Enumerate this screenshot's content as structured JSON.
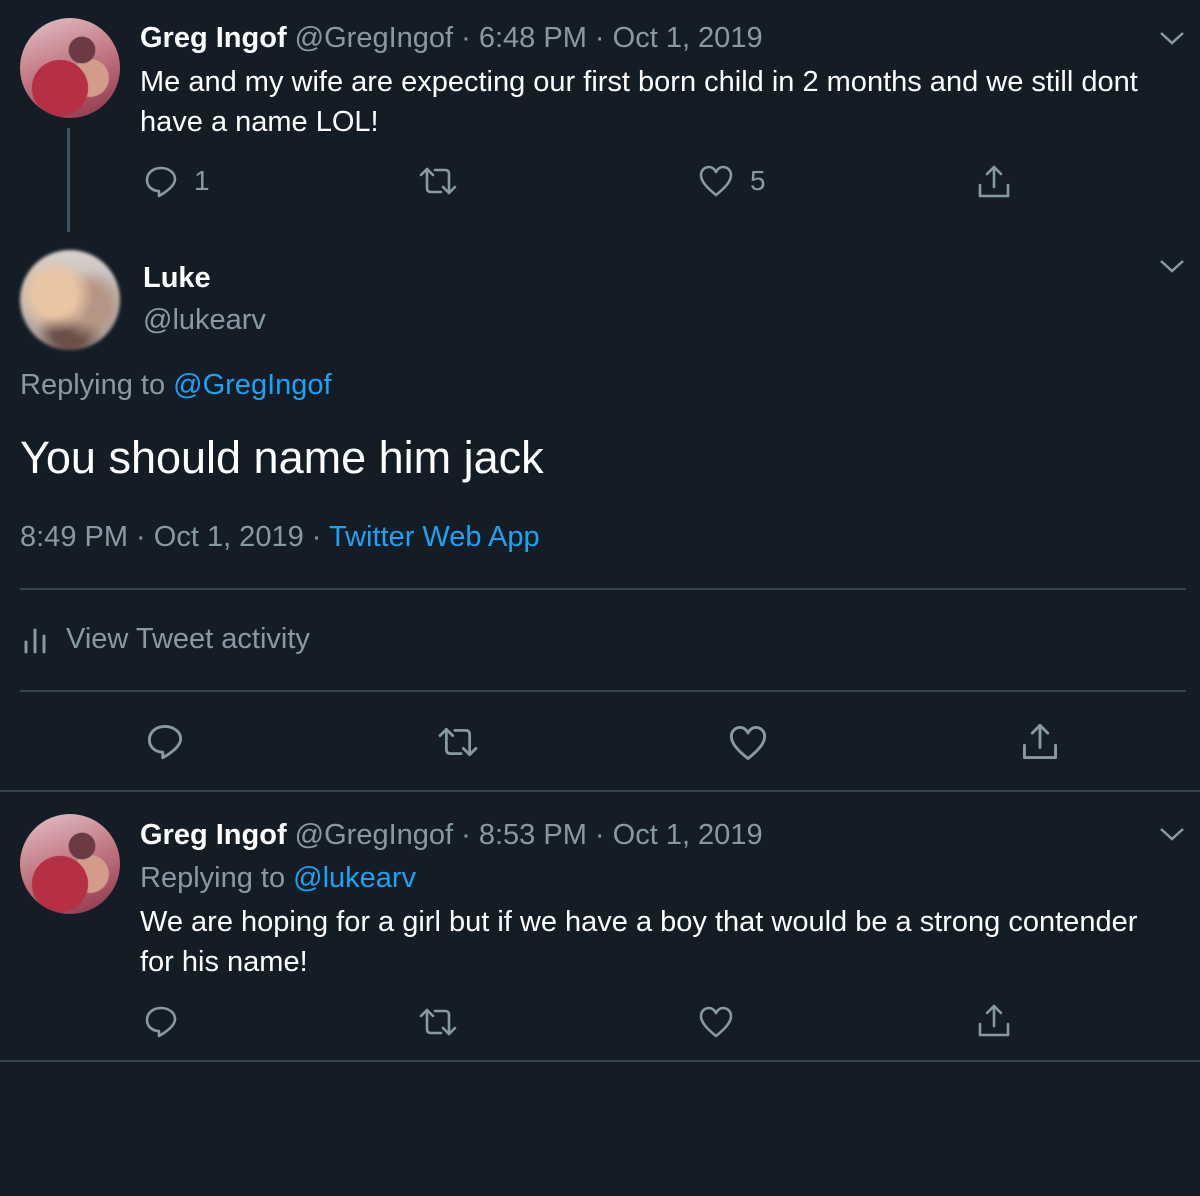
{
  "tweet1": {
    "name": "Greg Ingof",
    "handle": "@GregIngof",
    "time": "· 6:48 PM · Oct 1, 2019",
    "text": "Me and my wife are expecting our first born child in 2 months and we still dont have a name LOL!",
    "reply_count": "1",
    "like_count": "5"
  },
  "main_tweet": {
    "name": "Luke",
    "handle": "@lukearv",
    "replying_prefix": "Replying to",
    "replying_handle": "@GregIngof",
    "text": "You should name him jack",
    "timestamp": "8:49 PM · Oct 1, 2019 ·",
    "source": "Twitter Web App",
    "activity_label": "View Tweet activity"
  },
  "tweet3": {
    "name": "Greg Ingof",
    "handle": "@GregIngof",
    "time": "· 8:53 PM · Oct 1, 2019",
    "replying_prefix": "Replying to",
    "replying_handle": "@lukearv",
    "text": "We are hoping for a girl but if we have a boy that would be a strong contender for his name!"
  },
  "colors": {
    "background": "#141d26",
    "muted": "#8899a6",
    "link": "#1da1f2",
    "divider": "#38444d"
  },
  "icons": [
    "reply-icon",
    "retweet-icon",
    "like-icon",
    "share-icon",
    "chevron-down-icon",
    "analytics-icon"
  ]
}
